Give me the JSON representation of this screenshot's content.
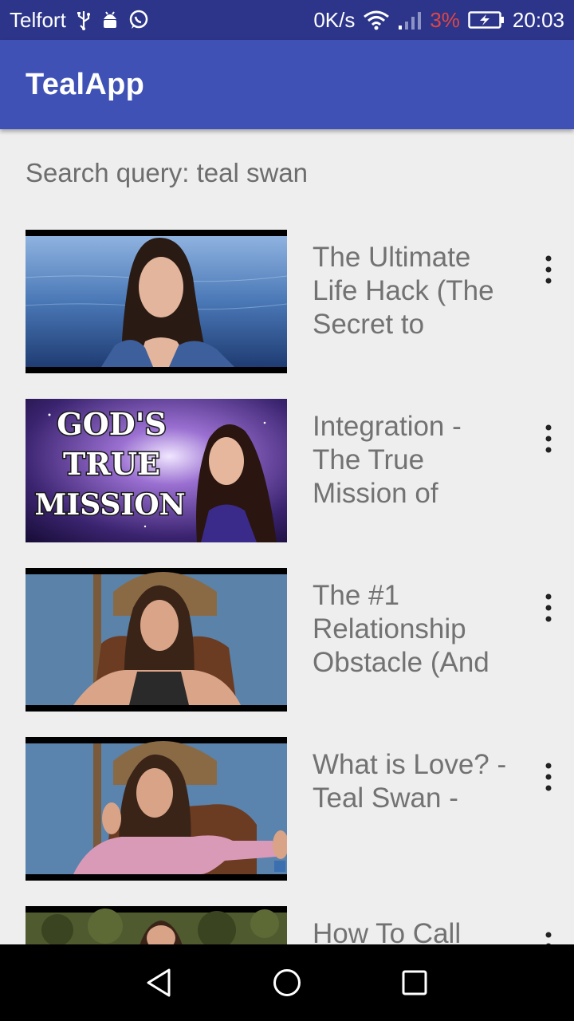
{
  "status_bar": {
    "carrier": "Telfort",
    "icons": [
      "usb-icon",
      "android-debug-icon",
      "whatsapp-icon"
    ],
    "speed": "0K/s",
    "battery_percent": "3%",
    "time": "20:03",
    "battery_color": "#e04545"
  },
  "app_bar": {
    "title": "TealApp",
    "color": "#3f51b5"
  },
  "search": {
    "query_text": "Search query: teal swan"
  },
  "results": [
    {
      "title": "The Ultimate Life Hack (The Secret to",
      "thumbnail": "woman-by-water"
    },
    {
      "title": "Integration - The True Mission of",
      "thumbnail_text": [
        "GOD'S",
        "TRUE",
        "MISSION"
      ]
    },
    {
      "title": "The #1 Relationship Obstacle (And",
      "thumbnail": "woman-in-chair"
    },
    {
      "title": "What is Love? - Teal Swan -",
      "thumbnail": "woman-gesturing"
    },
    {
      "title": "How To Call",
      "thumbnail": "woman-foliage"
    }
  ],
  "nav_bar": {
    "buttons": [
      "back-icon",
      "home-icon",
      "recents-icon"
    ]
  }
}
